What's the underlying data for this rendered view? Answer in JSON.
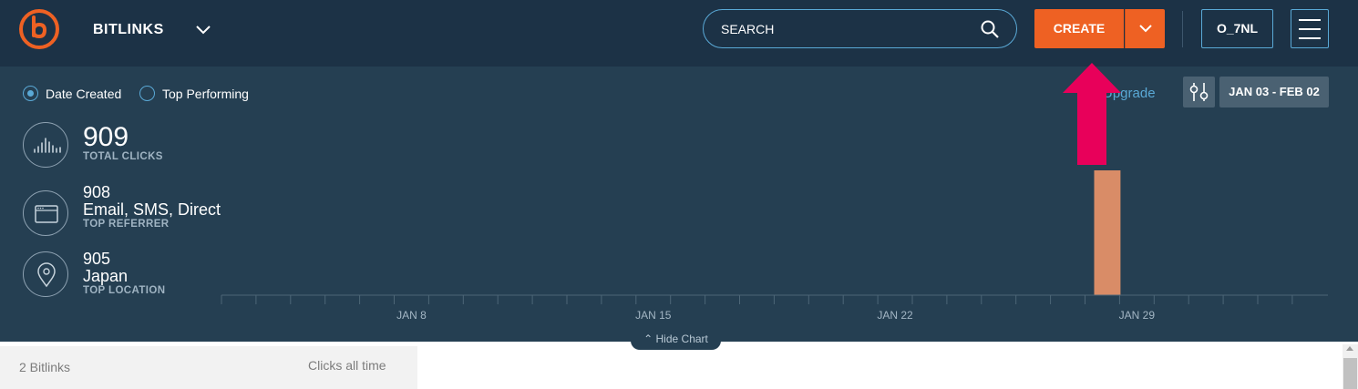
{
  "header": {
    "brand": "BITLINKS",
    "search_placeholder": "SEARCH",
    "create_label": "CREATE",
    "user_label": "O_7NL"
  },
  "filters": {
    "radio_date_created": "Date Created",
    "radio_top_performing": "Top Performing",
    "selected": "Date Created",
    "upgrade_label": "Upgrade",
    "date_range": "JAN 03 - FEB 02"
  },
  "stats": {
    "total_clicks": {
      "value": "909",
      "caption": "TOTAL CLICKS"
    },
    "top_referrer": {
      "value": "908",
      "name": "Email, SMS, Direct",
      "caption": "TOP REFERRER"
    },
    "top_location": {
      "value": "905",
      "name": "Japan",
      "caption": "TOP LOCATION"
    }
  },
  "chart_data": {
    "type": "bar",
    "x_tick_labels": [
      "JAN 8",
      "JAN 15",
      "JAN 22",
      "JAN 29"
    ],
    "start_date": "JAN 3",
    "day_count": 31,
    "bars": [
      {
        "date": "JAN 28",
        "value": 909
      }
    ],
    "ylim": [
      0,
      909
    ],
    "bar_color": "#d98c67"
  },
  "chart": {
    "hide_label": "Hide Chart"
  },
  "list": {
    "count_label": "2 Bitlinks",
    "clicks_label": "Clicks all time"
  },
  "colors": {
    "topbar": "#1c3246",
    "panel": "#253f52",
    "accent": "#ee6123",
    "link": "#5aa9d6",
    "annotation_arrow": "#e8005a"
  }
}
